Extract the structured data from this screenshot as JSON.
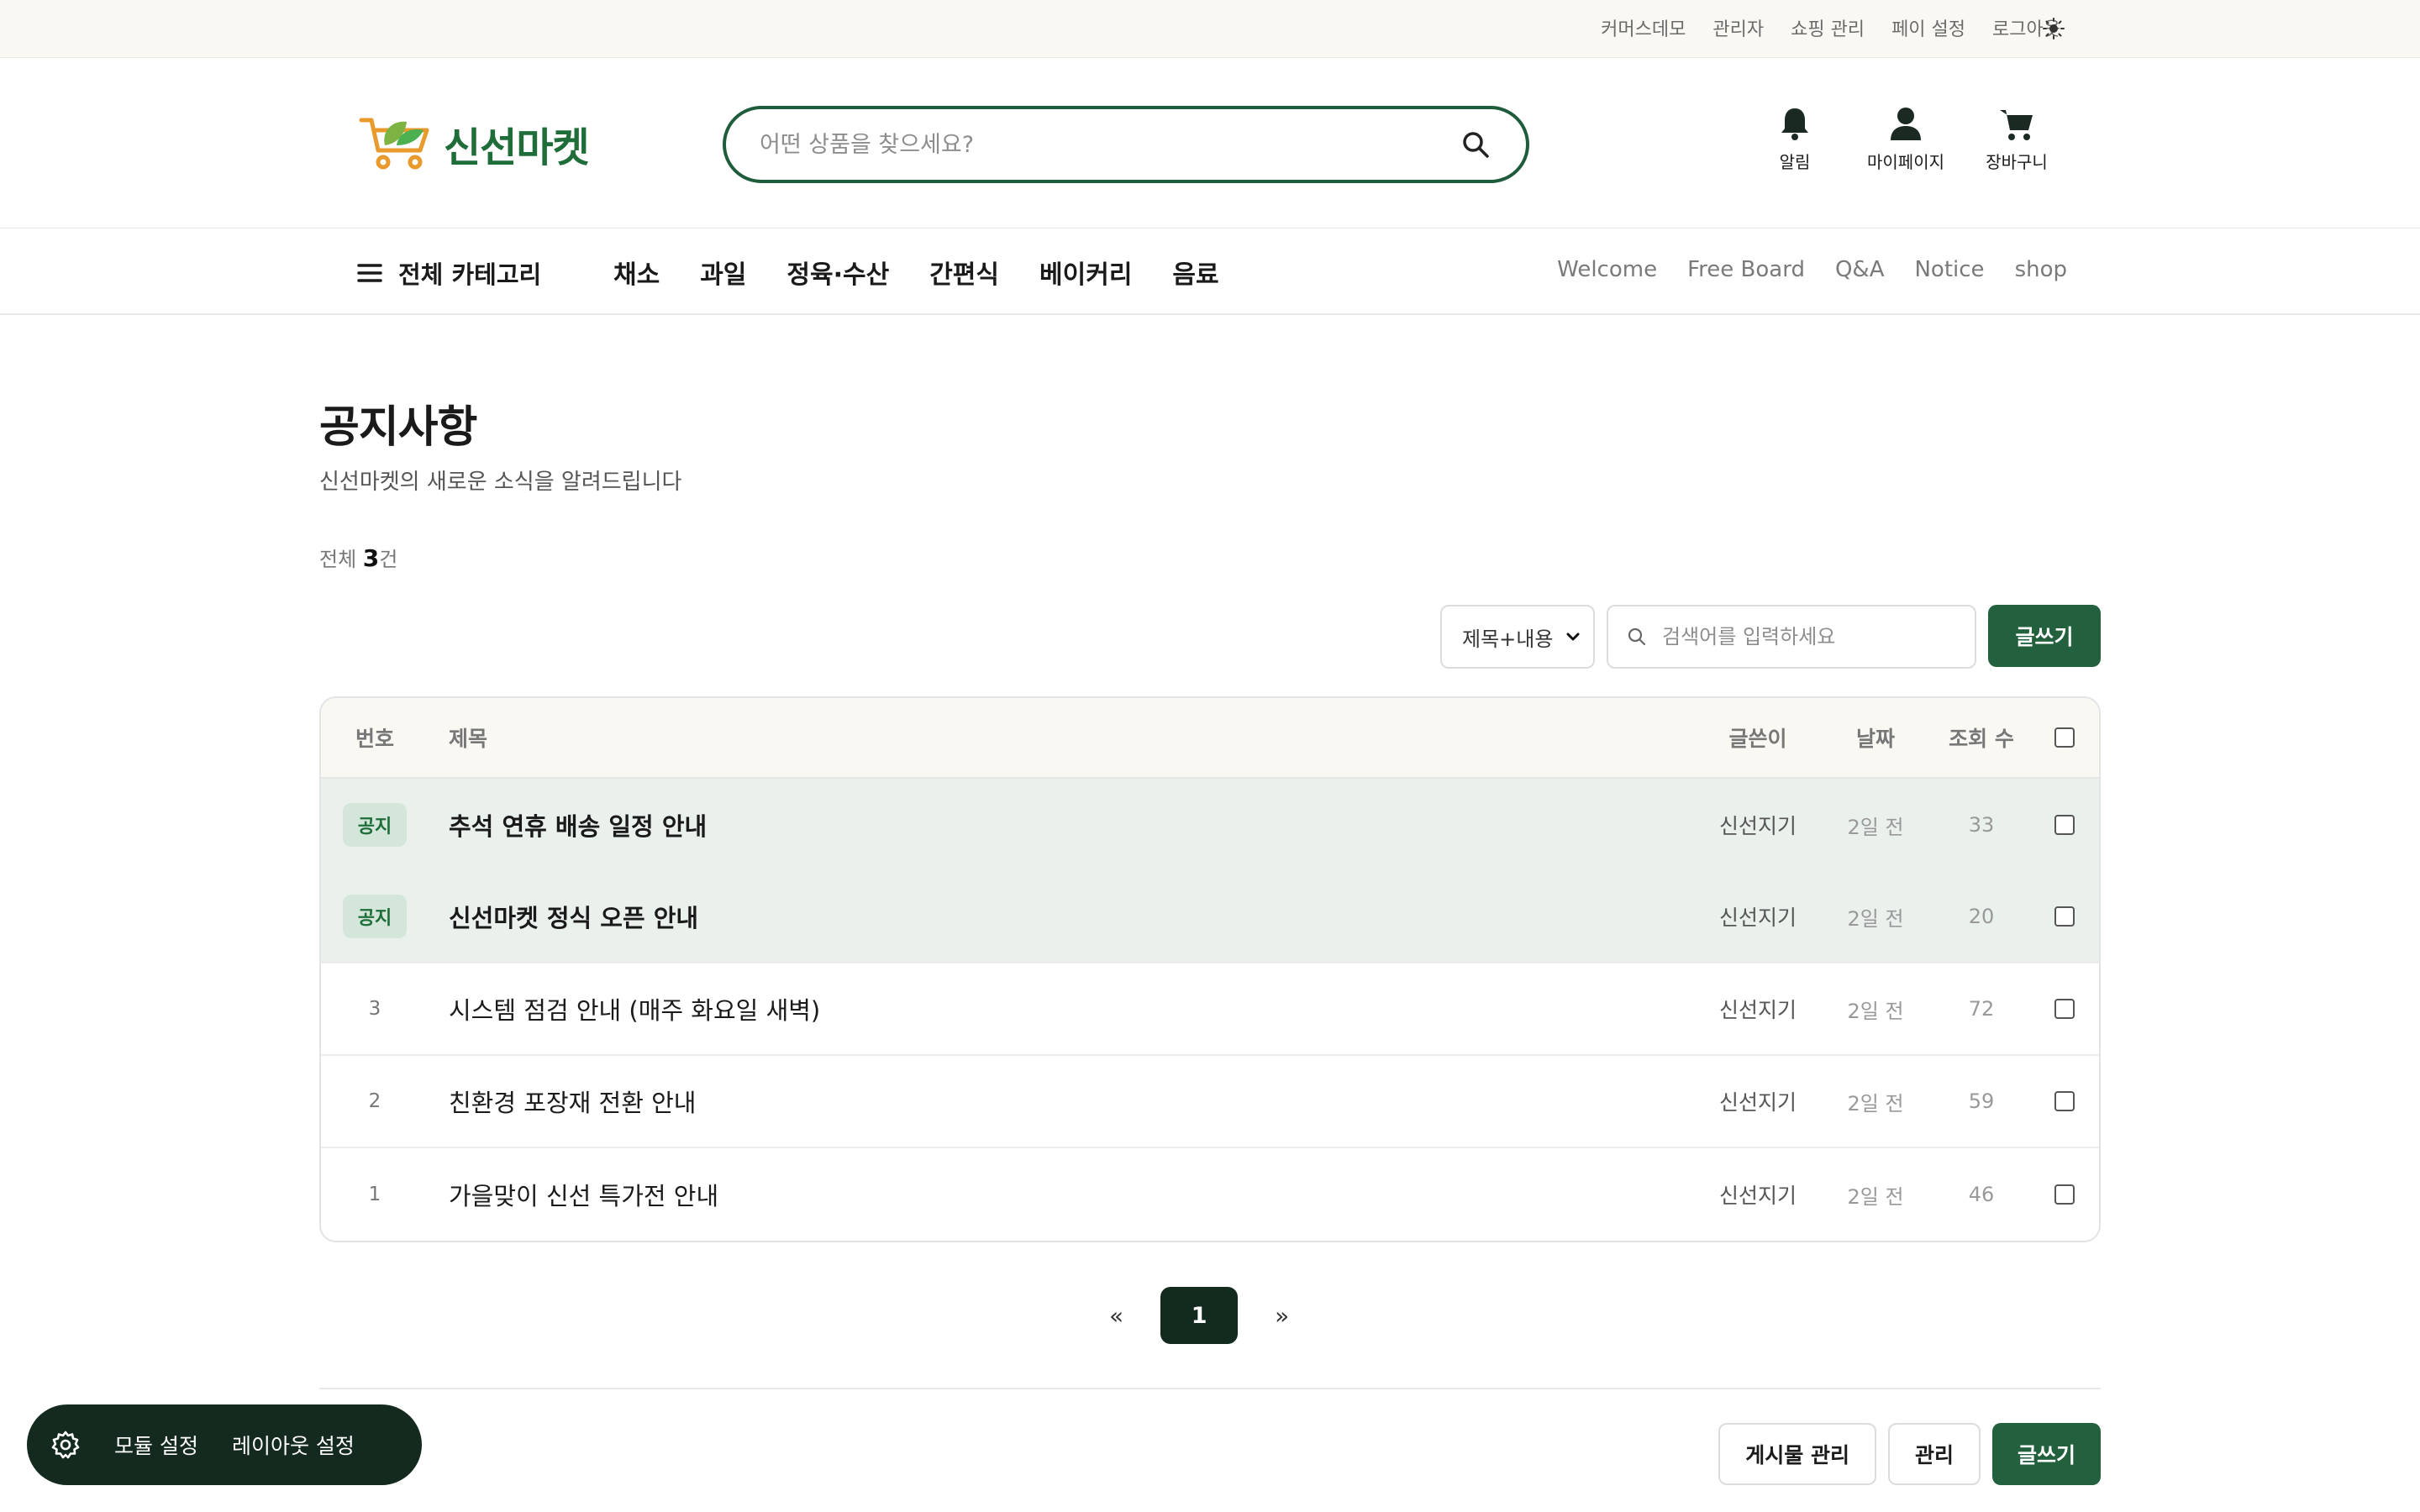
{
  "utility_links": [
    "커머스데모",
    "관리자",
    "쇼핑 관리",
    "페이 설정",
    "로그아웃"
  ],
  "logo": {
    "text": "신선마켓"
  },
  "header": {
    "search_placeholder": "어떤 상품을 찾으세요?",
    "icons": [
      {
        "label": "알림",
        "icon": "bell-icon"
      },
      {
        "label": "마이페이지",
        "icon": "user-icon"
      },
      {
        "label": "장바구니",
        "icon": "cart-icon"
      }
    ]
  },
  "nav": {
    "all_categories": "전체 카테고리",
    "categories": [
      "채소",
      "과일",
      "정육·수산",
      "간편식",
      "베이커리",
      "음료"
    ],
    "board_links": [
      "Welcome",
      "Free Board",
      "Q&A",
      "Notice",
      "shop"
    ]
  },
  "board": {
    "title": "공지사항",
    "subtitle": "신선마켓의 새로운 소식을 알려드립니다",
    "count_prefix": "전체 ",
    "count": "3",
    "count_suffix": "건",
    "search_select": "제목+내용",
    "search_placeholder": "검색어를 입력하세요",
    "write_label": "글쓰기",
    "columns": {
      "no": "번호",
      "title": "제목",
      "author": "글쓴이",
      "date": "날짜",
      "views": "조회 수"
    },
    "rows": [
      {
        "no": "공지",
        "title": "추석 연휴 배송 일정 안내",
        "author": "신선지기",
        "date": "2일 전",
        "views": "33"
      },
      {
        "no": "공지",
        "title": "신선마켓 정식 오픈 안내",
        "author": "신선지기",
        "date": "2일 전",
        "views": "20"
      },
      {
        "no": "3",
        "title": "시스템 점검 안내 (매주 화요일 새벽)",
        "author": "신선지기",
        "date": "2일 전",
        "views": "72"
      },
      {
        "no": "2",
        "title": "친환경 포장재 전환 안내",
        "author": "신선지기",
        "date": "2일 전",
        "views": "59"
      },
      {
        "no": "1",
        "title": "가을맞이 신선 특가전 안내",
        "author": "신선지기",
        "date": "2일 전",
        "views": "46"
      }
    ]
  },
  "pagination": {
    "prev": "«",
    "current": "1",
    "next": "»"
  },
  "bottom_buttons": {
    "manage_posts": "게시물 관리",
    "manage": "관리",
    "write": "글쓰기"
  },
  "floating": {
    "module_settings": "모듈 설정",
    "layout_settings": "레이아웃 설정"
  },
  "colors": {
    "brand": "#1f6e3a",
    "primary_button": "#23613e",
    "notice_row": "#eaf1ed",
    "dark": "#142a1e"
  }
}
